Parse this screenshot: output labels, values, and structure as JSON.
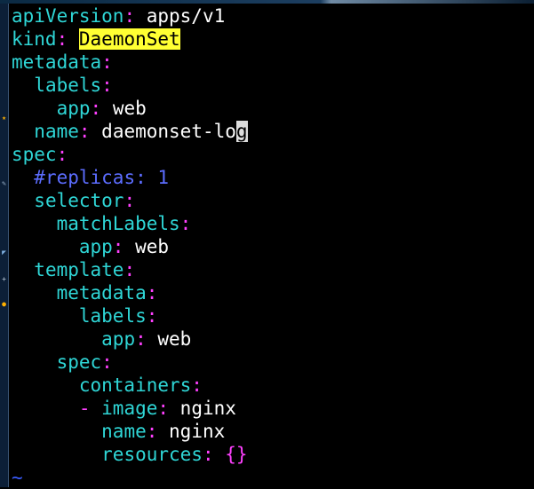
{
  "editor": {
    "lines": [
      {
        "indent": "",
        "key": "apiVersion",
        "sep": ":",
        "value": " apps/v1"
      },
      {
        "indent": "",
        "key": "kind",
        "sep": ":",
        "value_pre": " ",
        "value_highlighted": "DaemonSet"
      },
      {
        "indent": "",
        "key": "metadata",
        "sep": ":"
      },
      {
        "indent": "  ",
        "key": "labels",
        "sep": ":"
      },
      {
        "indent": "    ",
        "key": "app",
        "sep": ":",
        "value": " web"
      },
      {
        "indent": "  ",
        "key": "name",
        "sep": ":",
        "value": " daemonset-lo",
        "cursor_char": "g"
      },
      {
        "indent": "",
        "key": "spec",
        "sep": ":"
      },
      {
        "indent": "  ",
        "comment": "#replicas: 1"
      },
      {
        "indent": "  ",
        "key": "selector",
        "sep": ":"
      },
      {
        "indent": "    ",
        "key": "matchLabels",
        "sep": ":"
      },
      {
        "indent": "      ",
        "key": "app",
        "sep": ":",
        "value": " web"
      },
      {
        "indent": "  ",
        "key": "template",
        "sep": ":"
      },
      {
        "indent": "    ",
        "key": "metadata",
        "sep": ":"
      },
      {
        "indent": "      ",
        "key": "labels",
        "sep": ":"
      },
      {
        "indent": "        ",
        "key": "app",
        "sep": ":",
        "value": " web"
      },
      {
        "indent": "    ",
        "key": "spec",
        "sep": ":"
      },
      {
        "indent": "      ",
        "key": "containers",
        "sep": ":"
      },
      {
        "indent": "      ",
        "dash": "- ",
        "key": "image",
        "sep": ":",
        "value": " nginx"
      },
      {
        "indent": "        ",
        "key": "name",
        "sep": ":",
        "value": " nginx"
      },
      {
        "indent": "        ",
        "key": "resources",
        "sep": ":",
        "braces": " {}"
      }
    ],
    "tilde": "~"
  },
  "colors": {
    "background": "#000000",
    "key": "#2fd6d6",
    "punctuation": "#ff40ff",
    "highlight_bg": "#ffff33",
    "comment": "#5c6dff",
    "tilde": "#3a5cff"
  }
}
